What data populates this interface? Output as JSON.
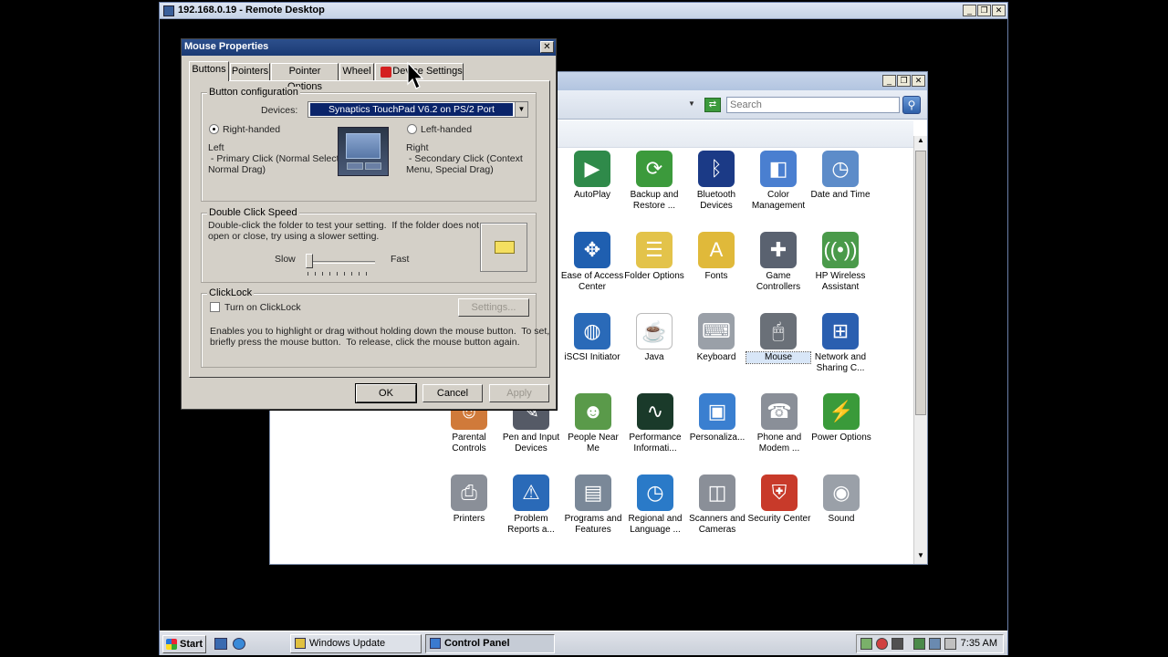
{
  "remote_desktop": {
    "title": "192.168.0.19 - Remote Desktop",
    "min": "_",
    "restore": "❐",
    "close": "✕"
  },
  "control_panel": {
    "search_placeholder": "Search",
    "search_icon": "magnifier-icon",
    "items": [
      {
        "label": "AutoPlay",
        "icon": "autoplay-icon",
        "color": "#2f8a4a",
        "glyph": "▶"
      },
      {
        "label": "Backup and Restore ...",
        "icon": "backup-icon",
        "color": "#3c9a3c",
        "glyph": "⟳"
      },
      {
        "label": "Bluetooth Devices",
        "icon": "bluetooth-icon",
        "color": "#1b3a86",
        "glyph": "ᛒ"
      },
      {
        "label": "Color Management",
        "icon": "color-management-icon",
        "color": "#4a7fd0",
        "glyph": "◧"
      },
      {
        "label": "Date and Time",
        "icon": "date-time-icon",
        "color": "#5d8cc9",
        "glyph": "◷"
      },
      {
        "label": "Ease of Access Center",
        "icon": "ease-of-access-icon",
        "color": "#1f5fb0",
        "glyph": "✥"
      },
      {
        "label": "Folder Options",
        "icon": "folder-options-icon",
        "color": "#e3c34a",
        "glyph": "☰"
      },
      {
        "label": "Fonts",
        "icon": "fonts-icon",
        "color": "#e0b93a",
        "glyph": "A"
      },
      {
        "label": "Game Controllers",
        "icon": "game-controller-icon",
        "color": "#5a6270",
        "glyph": "✚"
      },
      {
        "label": "HP Wireless Assistant",
        "icon": "wireless-icon",
        "color": "#4a9a4a",
        "glyph": "((•))"
      },
      {
        "label": "iSCSI Initiator",
        "icon": "iscsi-icon",
        "color": "#2a6ab8",
        "glyph": "◍"
      },
      {
        "label": "Java",
        "icon": "java-icon",
        "color": "#ffffff",
        "glyph": "☕"
      },
      {
        "label": "Keyboard",
        "icon": "keyboard-icon",
        "color": "#9aa0a8",
        "glyph": "⌨"
      },
      {
        "label": "Mouse",
        "icon": "mouse-icon",
        "color": "#6a7078",
        "glyph": "🖱"
      },
      {
        "label": "Network and Sharing C...",
        "icon": "network-icon",
        "color": "#2a5fb0",
        "glyph": "⊞"
      },
      {
        "label": "Parental Controls",
        "icon": "parental-controls-icon",
        "color": "#d07a3a",
        "glyph": "☺"
      },
      {
        "label": "Pen and Input Devices",
        "icon": "pen-icon",
        "color": "#555a66",
        "glyph": "✎"
      },
      {
        "label": "People Near Me",
        "icon": "people-icon",
        "color": "#5a9a4a",
        "glyph": "☻"
      },
      {
        "label": "Performance Informati...",
        "icon": "performance-icon",
        "color": "#1a3a2a",
        "glyph": "∿"
      },
      {
        "label": "Personaliza...",
        "icon": "personalization-icon",
        "color": "#3a7fd0",
        "glyph": "▣"
      },
      {
        "label": "Phone and Modem ...",
        "icon": "phone-icon",
        "color": "#8a8f98",
        "glyph": "☎"
      },
      {
        "label": "Power Options",
        "icon": "power-icon",
        "color": "#3a9a3a",
        "glyph": "⚡"
      },
      {
        "label": "Printers",
        "icon": "printer-icon",
        "color": "#8a8f98",
        "glyph": "⎙"
      },
      {
        "label": "Problem Reports a...",
        "icon": "problem-reports-icon",
        "color": "#2a6ab8",
        "glyph": "⚠"
      },
      {
        "label": "Programs and Features",
        "icon": "programs-icon",
        "color": "#7a8898",
        "glyph": "▤"
      },
      {
        "label": "Regional and Language ...",
        "icon": "regional-icon",
        "color": "#2a7ac8",
        "glyph": "◷"
      },
      {
        "label": "Scanners and Cameras",
        "icon": "scanner-icon",
        "color": "#8a8f98",
        "glyph": "◫"
      },
      {
        "label": "Security Center",
        "icon": "security-icon",
        "color": "#c83a2a",
        "glyph": "⛨"
      },
      {
        "label": "Sound",
        "icon": "sound-icon",
        "color": "#9aa0a8",
        "glyph": "◉"
      }
    ],
    "selected_item": "Mouse"
  },
  "dialog": {
    "title": "Mouse Properties",
    "close": "✕",
    "tabs": [
      "Buttons",
      "Pointers",
      "Pointer Options",
      "Wheel",
      "Device Settings"
    ],
    "active_tab": "Buttons",
    "button_config": {
      "group_title": "Button configuration",
      "devices_label": "Devices:",
      "device_value": "Synaptics TouchPad V6.2 on PS/2 Port",
      "right_handed": "Right-handed",
      "left_handed": "Left-handed",
      "left_title": "Left",
      "left_desc": " - Primary Click (Normal Select,\nNormal Drag)",
      "right_title": "Right",
      "right_desc": " - Secondary Click (Context\nMenu, Special Drag)"
    },
    "double_click": {
      "group_title": "Double Click Speed",
      "desc": "Double-click the folder to test your setting.  If the folder does not\nopen or close, try using a slower setting.",
      "slow": "Slow",
      "fast": "Fast",
      "speed_level": 0
    },
    "clicklock": {
      "group_title": "ClickLock",
      "checkbox_label": "Turn on ClickLock",
      "settings_button": "Settings...",
      "desc": "Enables you to highlight or drag without holding down the mouse button.  To set,\nbriefly press the mouse button.  To release, click the mouse button again."
    },
    "ok": "OK",
    "cancel": "Cancel",
    "apply": "Apply"
  },
  "taskbar": {
    "start": "Start",
    "buttons": [
      "Windows Update",
      "Control Panel"
    ],
    "active_button": "Control Panel",
    "clock": "7:35 AM"
  }
}
